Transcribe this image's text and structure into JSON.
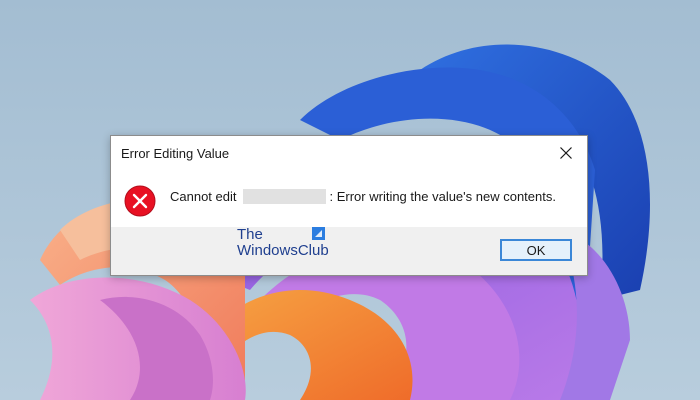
{
  "dialog": {
    "title": "Error Editing Value",
    "message_prefix": "Cannot edit",
    "message_suffix": ":  Error writing the value's new contents.",
    "ok_label": "OK",
    "icon": "error-icon",
    "close_icon": "close-icon"
  },
  "watermark": {
    "line1": "The",
    "line2": "WindowsClub"
  },
  "colors": {
    "error_red": "#e81123",
    "ok_border": "#3b87d7",
    "footer_bg": "#f0f0f0",
    "watermark": "#1f3f8f"
  }
}
